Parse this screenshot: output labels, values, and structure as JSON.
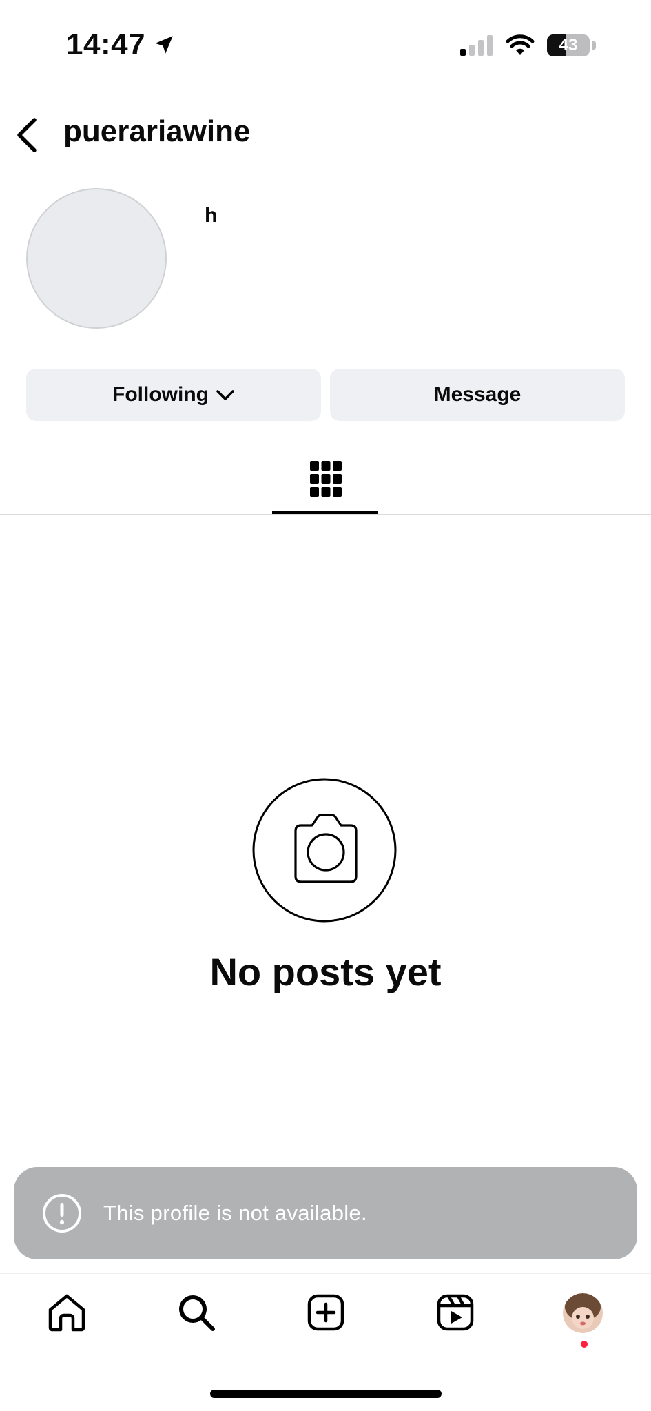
{
  "status_bar": {
    "time": "14:47",
    "battery": "43",
    "battery_level": 0.43,
    "icons": [
      "location-arrow-icon",
      "cellular-signal-icon",
      "wifi-icon",
      "battery-icon"
    ]
  },
  "header": {
    "username": "puerariawine",
    "back_icon": "chevron-left-icon"
  },
  "profile": {
    "display_name": "h",
    "buttons": {
      "following_label": "Following",
      "message_label": "Message"
    }
  },
  "tabs": {
    "active": "grid",
    "icons": [
      "grid-icon"
    ]
  },
  "empty_state": {
    "title": "No posts yet",
    "icon": "camera-icon"
  },
  "toast": {
    "message": "This profile is not available.",
    "icon": "exclamation-circle-icon"
  },
  "bottom_nav": {
    "items": [
      "home-icon",
      "search-icon",
      "create-icon",
      "reels-icon",
      "profile-avatar"
    ],
    "notification_dot_color": "#ff1e3c"
  },
  "colors": {
    "button_bg": "#eff0f3",
    "toast_bg": "#b1b2b4",
    "avatar_placeholder": "#e9ebee"
  }
}
